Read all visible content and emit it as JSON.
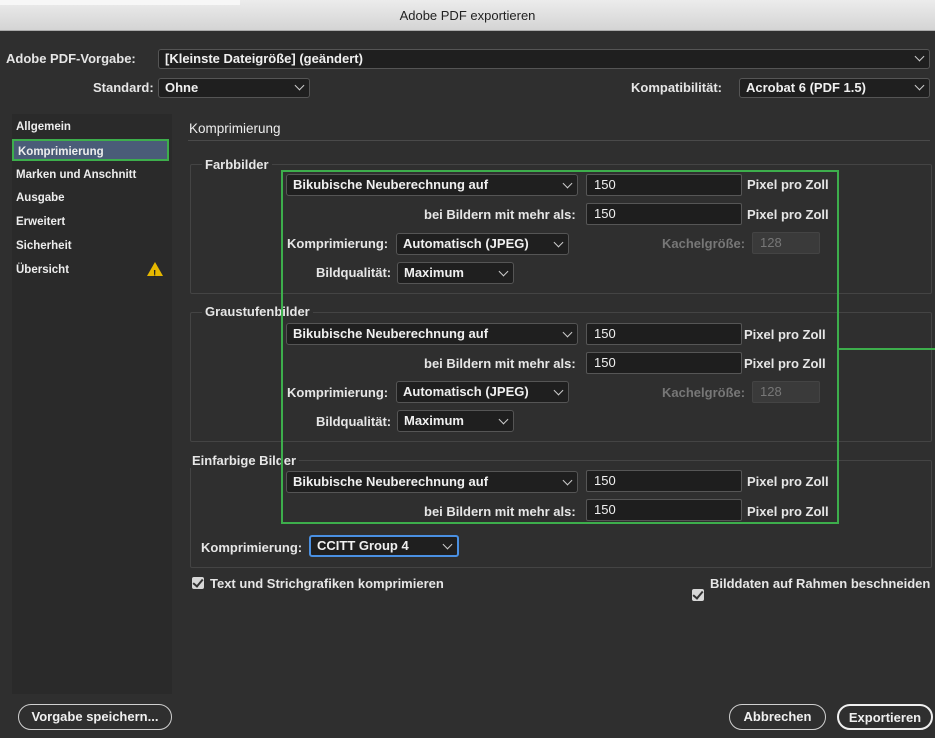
{
  "window": {
    "title": "Adobe PDF exportieren"
  },
  "header": {
    "preset_label": "Adobe PDF-Vorgabe:",
    "preset_value": "[Kleinste Dateigröße] (geändert)",
    "standard_label": "Standard:",
    "standard_value": "Ohne",
    "compat_label": "Kompatibilität:",
    "compat_value": "Acrobat 6 (PDF 1.5)"
  },
  "sidebar": {
    "items": [
      {
        "label": "Allgemein"
      },
      {
        "label": "Komprimierung"
      },
      {
        "label": "Marken und Anschnitt"
      },
      {
        "label": "Ausgabe"
      },
      {
        "label": "Erweitert"
      },
      {
        "label": "Sicherheit"
      },
      {
        "label": "Übersicht"
      }
    ],
    "warning_glyph": "!"
  },
  "main": {
    "section_title": "Komprimierung",
    "color": {
      "title": "Farbbilder",
      "resample_value": "Bikubische Neuberechnung auf",
      "resample_ppi": "150",
      "unit": "Pixel pro Zoll",
      "above_label": "bei Bildern mit mehr als:",
      "above_ppi": "150",
      "compression_label": "Komprimierung:",
      "compression_value": "Automatisch (JPEG)",
      "tile_label": "Kachelgröße:",
      "tile_value": "128",
      "quality_label": "Bildqualität:",
      "quality_value": "Maximum"
    },
    "gray": {
      "title": "Graustufenbilder",
      "resample_value": "Bikubische Neuberechnung auf",
      "resample_ppi": "150",
      "unit": "Pixel pro Zoll",
      "above_label": "bei Bildern mit mehr als:",
      "above_ppi": "150",
      "compression_label": "Komprimierung:",
      "compression_value": "Automatisch (JPEG)",
      "tile_label": "Kachelgröße:",
      "tile_value": "128",
      "quality_label": "Bildqualität:",
      "quality_value": "Maximum"
    },
    "mono": {
      "title": "Einfarbige Bilder",
      "resample_value": "Bikubische Neuberechnung auf",
      "resample_ppi": "150",
      "unit": "Pixel pro Zoll",
      "above_label": "bei Bildern mit mehr als:",
      "above_ppi": "150",
      "compression_label": "Komprimierung:",
      "compression_value": "CCITT Group 4"
    },
    "compress_text_label": "Text und Strichgrafiken komprimieren",
    "crop_label": "Bilddaten auf Rahmen beschneiden"
  },
  "footer": {
    "save_preset": "Vorgabe speichern...",
    "cancel": "Abbrechen",
    "export": "Exportieren"
  }
}
